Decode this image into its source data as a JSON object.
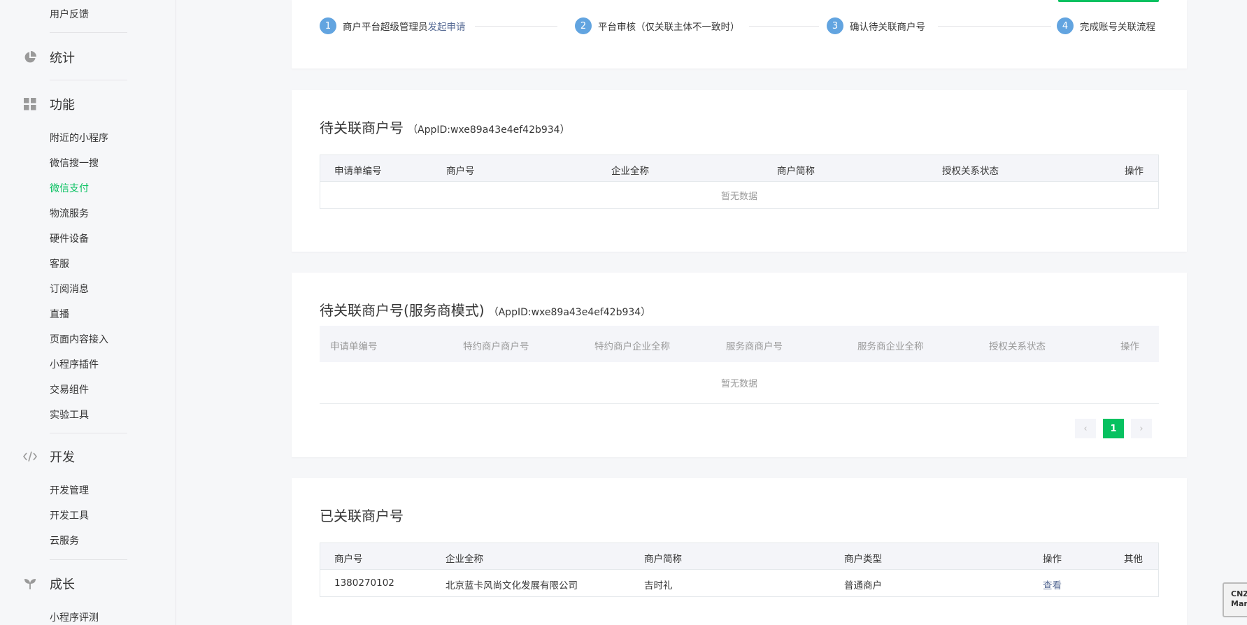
{
  "sidebar": {
    "items": [
      {
        "label": "用户反馈"
      },
      {
        "label": "附近的小程序"
      },
      {
        "label": "微信搜一搜"
      },
      {
        "label": "微信支付"
      },
      {
        "label": "物流服务"
      },
      {
        "label": "硬件设备"
      },
      {
        "label": "客服"
      },
      {
        "label": "订阅消息"
      },
      {
        "label": "直播"
      },
      {
        "label": "页面内容接入"
      },
      {
        "label": "小程序插件"
      },
      {
        "label": "交易组件"
      },
      {
        "label": "实验工具"
      },
      {
        "label": "开发管理"
      },
      {
        "label": "开发工具"
      },
      {
        "label": "云服务"
      },
      {
        "label": "小程序评测"
      }
    ],
    "groups": [
      {
        "label": "统计",
        "icon": "pie-chart-icon"
      },
      {
        "label": "功能",
        "icon": "grid-icon"
      },
      {
        "label": "开发",
        "icon": "code-icon"
      },
      {
        "label": "成长",
        "icon": "sprout-icon"
      }
    ],
    "active_color": "#07c160"
  },
  "steps": [
    {
      "num": "1",
      "text": "商户平台超级管理员",
      "link": "发起申请"
    },
    {
      "num": "2",
      "text": "平台审核（仅关联主体不一致时）"
    },
    {
      "num": "3",
      "text": "确认待关联商户号"
    },
    {
      "num": "4",
      "text": "完成账号关联流程"
    }
  ],
  "pending": {
    "title": "待关联商户号",
    "appid": "（AppID:wxe89a43e4ef42b934）",
    "columns": [
      "申请单编号",
      "商户号",
      "企业全称",
      "商户简称",
      "授权关系状态",
      "操作"
    ],
    "empty": "暂无数据"
  },
  "pending_sp": {
    "title": "待关联商户号(服务商模式)",
    "appid": "（AppID:wxe89a43e4ef42b934）",
    "columns": [
      "申请单编号",
      "特约商户商户号",
      "特约商户企业全称",
      "服务商商户号",
      "服务商企业全称",
      "授权关系状态",
      "操作"
    ],
    "empty": "暂无数据",
    "pager": {
      "prev": "‹",
      "current": "1",
      "next": "›"
    }
  },
  "linked": {
    "title": "已关联商户号",
    "columns": [
      "商户号",
      "企业全称",
      "商户简称",
      "商户类型",
      "操作",
      "其他"
    ],
    "rows": [
      {
        "mchid": "1380270102",
        "company": "北京蓝卡风尚文化发展有限公司",
        "short": "吉时礼",
        "type": "普通商户",
        "action": "查看",
        "other": ""
      }
    ]
  },
  "badge": {
    "line1": "CNZ",
    "line2": "Mar"
  },
  "colors": {
    "accent": "#07c160",
    "link": "#576b95",
    "step": "#62a4e0"
  }
}
